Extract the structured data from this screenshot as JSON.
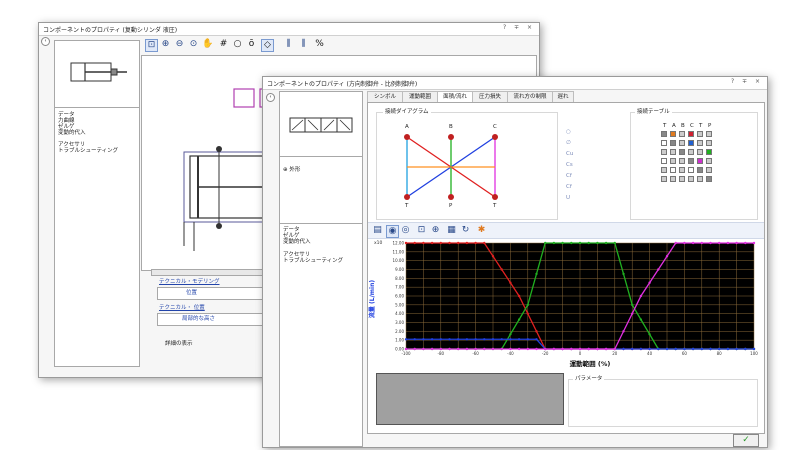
{
  "back_window": {
    "title": "コンポーネントのプロパティ (复動シリンダ  液圧)",
    "controls": "? ∓ ×",
    "left_nav": [
      "データ",
      "力曲線",
      "ゼルゲ",
      "変動的代入",
      "アクセサリ",
      "トラブルシューティング"
    ],
    "toolbar_icons": [
      "zoom-fit-icon",
      "zoom-in-icon",
      "zoom-out-icon",
      "zoom-region-icon",
      "pan-icon",
      "grid-icon",
      "circle-icon",
      "connection-icon",
      "select-icon",
      "waveform-icon",
      "waveform-alt-icon",
      "percent-icon"
    ],
    "sections": {
      "technical_modeling": "テクニカル・モデリング",
      "technical_modeling_value": "位置",
      "technical_position": "テクニカル・ 位置",
      "technical_position_value": "局部的な高さ",
      "details": "詳細の表示"
    }
  },
  "front_window": {
    "title": "コンポーネントのプロパティ (方向制御弁 - 比例制御弁)",
    "controls": "? ∓ ×",
    "left_nav": [
      "データ",
      "ゼルゲ",
      "変動的代入",
      "アクセサリ",
      "トラブルシューティング"
    ],
    "tree_item": "⊕ 外形",
    "tabs": [
      "シンボル",
      "運動範囲",
      "面積/流れ",
      "圧力損失",
      "流れ方の制限",
      "遅れ"
    ],
    "active_tab": 2,
    "connection_diagram_title": "接続ダイアグラム",
    "connection_table_title": "接続テーブル",
    "ports": [
      "A",
      "B",
      "C",
      "T",
      "P",
      "T"
    ],
    "flow_list": [
      "○",
      "∅",
      "Cu",
      "Cs",
      "Cf",
      "Cf",
      "U"
    ],
    "table_headers": [
      "T",
      "A",
      "B",
      "C",
      "T",
      "P"
    ],
    "param_label": "パラメータ",
    "ok_symbol": "✓"
  },
  "chart_data": {
    "type": "line",
    "xlabel": "運動範囲 (%)",
    "ylabel": "流量 (L/min)",
    "y_exponent": "x10",
    "xlim": [
      -100,
      100
    ],
    "ylim": [
      0,
      12
    ],
    "x_ticks": [
      -100,
      -80,
      -60,
      -40,
      -20,
      0,
      20,
      40,
      60,
      80,
      100
    ],
    "y_ticks": [
      "12.00",
      "11.00",
      "10.00",
      "9.00",
      "8.00",
      "7.00",
      "6.00",
      "5.00",
      "4.00",
      "3.00",
      "2.00",
      "1.00",
      "0.00"
    ],
    "grid": true,
    "series": [
      {
        "color": "#e02020",
        "x": [
          -100,
          -55,
          -35,
          -20,
          100
        ],
        "y": [
          12,
          12,
          6,
          0,
          0
        ]
      },
      {
        "color": "#20b020",
        "x": [
          -100,
          -45,
          -30,
          -20,
          20,
          30,
          45,
          100
        ],
        "y": [
          0,
          0,
          5,
          12,
          12,
          5,
          0,
          0
        ]
      },
      {
        "color": "#2040e0",
        "x": [
          -100,
          -25,
          -20,
          100
        ],
        "y": [
          1.1,
          1.1,
          0,
          0
        ]
      },
      {
        "color": "#e030e0",
        "x": [
          -100,
          20,
          35,
          55,
          100
        ],
        "y": [
          0,
          0,
          6,
          12,
          12
        ]
      }
    ]
  }
}
